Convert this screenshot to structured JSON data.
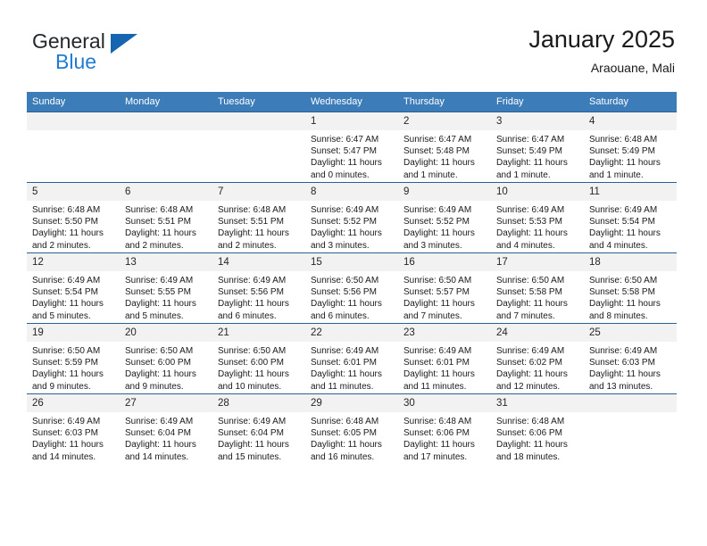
{
  "brand": {
    "name_part1": "General",
    "name_part2": "Blue",
    "triangle_color": "#1565b0",
    "blue_color": "#1f7cd0"
  },
  "header": {
    "title": "January 2025",
    "subtitle": "Araouane, Mali"
  },
  "theme": {
    "header_row_background": "#3c7cb8",
    "header_row_text": "#ffffff",
    "daynum_background": "#f2f2f2",
    "row_divider": "#2b5f96",
    "cell_background": "#ffffff"
  },
  "weekdays": [
    "Sunday",
    "Monday",
    "Tuesday",
    "Wednesday",
    "Thursday",
    "Friday",
    "Saturday"
  ],
  "weeks": [
    [
      {
        "day": "",
        "sunrise": "",
        "sunset": "",
        "daylight1": "",
        "daylight2": ""
      },
      {
        "day": "",
        "sunrise": "",
        "sunset": "",
        "daylight1": "",
        "daylight2": ""
      },
      {
        "day": "",
        "sunrise": "",
        "sunset": "",
        "daylight1": "",
        "daylight2": ""
      },
      {
        "day": "1",
        "sunrise": "Sunrise: 6:47 AM",
        "sunset": "Sunset: 5:47 PM",
        "daylight1": "Daylight: 11 hours",
        "daylight2": "and 0 minutes."
      },
      {
        "day": "2",
        "sunrise": "Sunrise: 6:47 AM",
        "sunset": "Sunset: 5:48 PM",
        "daylight1": "Daylight: 11 hours",
        "daylight2": "and 1 minute."
      },
      {
        "day": "3",
        "sunrise": "Sunrise: 6:47 AM",
        "sunset": "Sunset: 5:49 PM",
        "daylight1": "Daylight: 11 hours",
        "daylight2": "and 1 minute."
      },
      {
        "day": "4",
        "sunrise": "Sunrise: 6:48 AM",
        "sunset": "Sunset: 5:49 PM",
        "daylight1": "Daylight: 11 hours",
        "daylight2": "and 1 minute."
      }
    ],
    [
      {
        "day": "5",
        "sunrise": "Sunrise: 6:48 AM",
        "sunset": "Sunset: 5:50 PM",
        "daylight1": "Daylight: 11 hours",
        "daylight2": "and 2 minutes."
      },
      {
        "day": "6",
        "sunrise": "Sunrise: 6:48 AM",
        "sunset": "Sunset: 5:51 PM",
        "daylight1": "Daylight: 11 hours",
        "daylight2": "and 2 minutes."
      },
      {
        "day": "7",
        "sunrise": "Sunrise: 6:48 AM",
        "sunset": "Sunset: 5:51 PM",
        "daylight1": "Daylight: 11 hours",
        "daylight2": "and 2 minutes."
      },
      {
        "day": "8",
        "sunrise": "Sunrise: 6:49 AM",
        "sunset": "Sunset: 5:52 PM",
        "daylight1": "Daylight: 11 hours",
        "daylight2": "and 3 minutes."
      },
      {
        "day": "9",
        "sunrise": "Sunrise: 6:49 AM",
        "sunset": "Sunset: 5:52 PM",
        "daylight1": "Daylight: 11 hours",
        "daylight2": "and 3 minutes."
      },
      {
        "day": "10",
        "sunrise": "Sunrise: 6:49 AM",
        "sunset": "Sunset: 5:53 PM",
        "daylight1": "Daylight: 11 hours",
        "daylight2": "and 4 minutes."
      },
      {
        "day": "11",
        "sunrise": "Sunrise: 6:49 AM",
        "sunset": "Sunset: 5:54 PM",
        "daylight1": "Daylight: 11 hours",
        "daylight2": "and 4 minutes."
      }
    ],
    [
      {
        "day": "12",
        "sunrise": "Sunrise: 6:49 AM",
        "sunset": "Sunset: 5:54 PM",
        "daylight1": "Daylight: 11 hours",
        "daylight2": "and 5 minutes."
      },
      {
        "day": "13",
        "sunrise": "Sunrise: 6:49 AM",
        "sunset": "Sunset: 5:55 PM",
        "daylight1": "Daylight: 11 hours",
        "daylight2": "and 5 minutes."
      },
      {
        "day": "14",
        "sunrise": "Sunrise: 6:49 AM",
        "sunset": "Sunset: 5:56 PM",
        "daylight1": "Daylight: 11 hours",
        "daylight2": "and 6 minutes."
      },
      {
        "day": "15",
        "sunrise": "Sunrise: 6:50 AM",
        "sunset": "Sunset: 5:56 PM",
        "daylight1": "Daylight: 11 hours",
        "daylight2": "and 6 minutes."
      },
      {
        "day": "16",
        "sunrise": "Sunrise: 6:50 AM",
        "sunset": "Sunset: 5:57 PM",
        "daylight1": "Daylight: 11 hours",
        "daylight2": "and 7 minutes."
      },
      {
        "day": "17",
        "sunrise": "Sunrise: 6:50 AM",
        "sunset": "Sunset: 5:58 PM",
        "daylight1": "Daylight: 11 hours",
        "daylight2": "and 7 minutes."
      },
      {
        "day": "18",
        "sunrise": "Sunrise: 6:50 AM",
        "sunset": "Sunset: 5:58 PM",
        "daylight1": "Daylight: 11 hours",
        "daylight2": "and 8 minutes."
      }
    ],
    [
      {
        "day": "19",
        "sunrise": "Sunrise: 6:50 AM",
        "sunset": "Sunset: 5:59 PM",
        "daylight1": "Daylight: 11 hours",
        "daylight2": "and 9 minutes."
      },
      {
        "day": "20",
        "sunrise": "Sunrise: 6:50 AM",
        "sunset": "Sunset: 6:00 PM",
        "daylight1": "Daylight: 11 hours",
        "daylight2": "and 9 minutes."
      },
      {
        "day": "21",
        "sunrise": "Sunrise: 6:50 AM",
        "sunset": "Sunset: 6:00 PM",
        "daylight1": "Daylight: 11 hours",
        "daylight2": "and 10 minutes."
      },
      {
        "day": "22",
        "sunrise": "Sunrise: 6:49 AM",
        "sunset": "Sunset: 6:01 PM",
        "daylight1": "Daylight: 11 hours",
        "daylight2": "and 11 minutes."
      },
      {
        "day": "23",
        "sunrise": "Sunrise: 6:49 AM",
        "sunset": "Sunset: 6:01 PM",
        "daylight1": "Daylight: 11 hours",
        "daylight2": "and 11 minutes."
      },
      {
        "day": "24",
        "sunrise": "Sunrise: 6:49 AM",
        "sunset": "Sunset: 6:02 PM",
        "daylight1": "Daylight: 11 hours",
        "daylight2": "and 12 minutes."
      },
      {
        "day": "25",
        "sunrise": "Sunrise: 6:49 AM",
        "sunset": "Sunset: 6:03 PM",
        "daylight1": "Daylight: 11 hours",
        "daylight2": "and 13 minutes."
      }
    ],
    [
      {
        "day": "26",
        "sunrise": "Sunrise: 6:49 AM",
        "sunset": "Sunset: 6:03 PM",
        "daylight1": "Daylight: 11 hours",
        "daylight2": "and 14 minutes."
      },
      {
        "day": "27",
        "sunrise": "Sunrise: 6:49 AM",
        "sunset": "Sunset: 6:04 PM",
        "daylight1": "Daylight: 11 hours",
        "daylight2": "and 14 minutes."
      },
      {
        "day": "28",
        "sunrise": "Sunrise: 6:49 AM",
        "sunset": "Sunset: 6:04 PM",
        "daylight1": "Daylight: 11 hours",
        "daylight2": "and 15 minutes."
      },
      {
        "day": "29",
        "sunrise": "Sunrise: 6:48 AM",
        "sunset": "Sunset: 6:05 PM",
        "daylight1": "Daylight: 11 hours",
        "daylight2": "and 16 minutes."
      },
      {
        "day": "30",
        "sunrise": "Sunrise: 6:48 AM",
        "sunset": "Sunset: 6:06 PM",
        "daylight1": "Daylight: 11 hours",
        "daylight2": "and 17 minutes."
      },
      {
        "day": "31",
        "sunrise": "Sunrise: 6:48 AM",
        "sunset": "Sunset: 6:06 PM",
        "daylight1": "Daylight: 11 hours",
        "daylight2": "and 18 minutes."
      },
      {
        "day": "",
        "sunrise": "",
        "sunset": "",
        "daylight1": "",
        "daylight2": ""
      }
    ]
  ]
}
